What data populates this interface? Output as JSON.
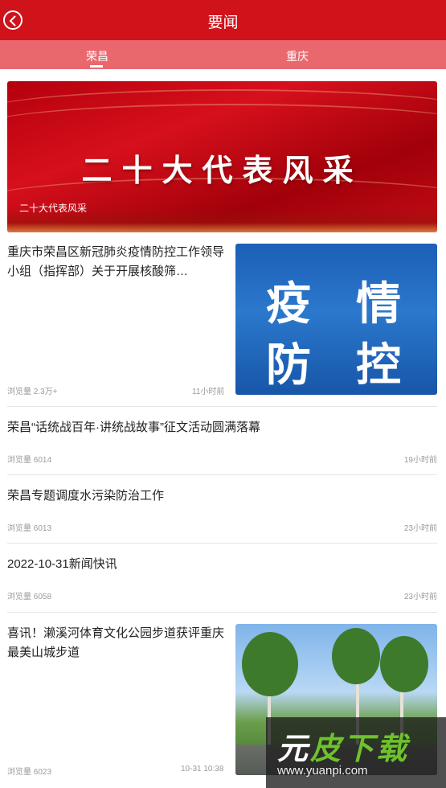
{
  "header": {
    "title": "要闻"
  },
  "tabs": [
    {
      "label": "荣昌",
      "active": true
    },
    {
      "label": "重庆",
      "active": false
    }
  ],
  "banner": {
    "headline": "二十大代表风采",
    "caption": "二十大代表风采"
  },
  "news": [
    {
      "title": "重庆市荣昌区新冠肺炎疫情防控工作领导小组（指挥部）关于开展核酸筛…",
      "views": "浏览量 2.3万+",
      "time": "11小时前",
      "thumb_text": [
        "疫",
        "情",
        "防",
        "控"
      ]
    },
    {
      "title": "荣昌“话统战百年·讲统战故事”征文活动圆满落幕",
      "views": "浏览量 6014",
      "time": "19小时前"
    },
    {
      "title": "荣昌专题调度水污染防治工作",
      "views": "浏览量 6013",
      "time": "23小时前"
    },
    {
      "title": "2022-10-31新闻快讯",
      "views": "浏览量 6058",
      "time": "23小时前"
    },
    {
      "title": "喜讯！濑溪河体育文化公园步道获评重庆最美山城步道",
      "views": "浏览量 6023",
      "time": "10-31 10:38"
    }
  ],
  "watermark": {
    "logo_a": "元",
    "logo_b": "皮下载",
    "url": "www.yuanpi.com"
  },
  "colors": {
    "primary": "#d0121b",
    "tabbar": "#e9686e"
  }
}
